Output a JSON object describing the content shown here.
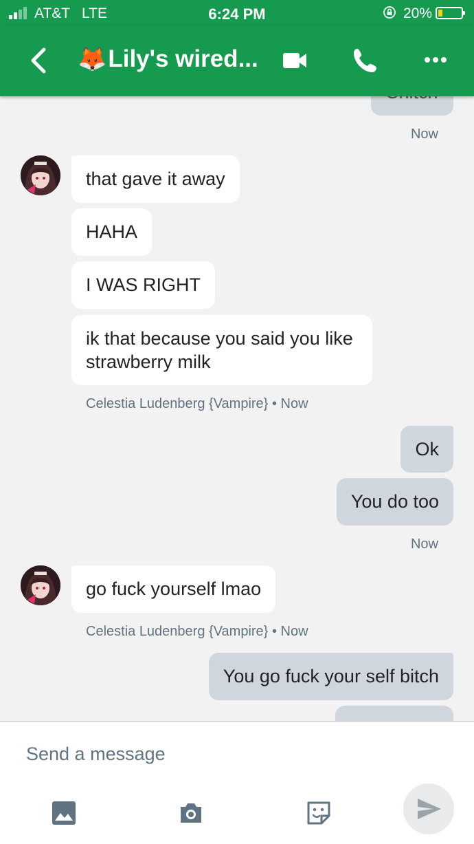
{
  "status_bar": {
    "carrier": "AT&T",
    "network": "LTE",
    "time": "6:24 PM",
    "battery_percent": "20%",
    "battery_level": 0.2,
    "signal_bars": 2,
    "icons": [
      "signal-icon",
      "orientation-lock-icon",
      "battery-icon"
    ]
  },
  "header": {
    "emoji": "🦊",
    "title": "Lily's wired...",
    "icons": [
      "back-icon",
      "video-call-icon",
      "phone-call-icon",
      "more-icon"
    ]
  },
  "messages": {
    "partial_top_text": "Chitch",
    "ts1": "Now",
    "in1": [
      "that gave it away",
      "HAHA",
      "I WAS RIGHT",
      "ik that because you said you like",
      "strawberry milk"
    ],
    "sender1": "Celestia Ludenberg {Vampire}",
    "sender1_time": "• Now",
    "out1": [
      "Ok",
      "You do too"
    ],
    "ts2": "Now",
    "in2": "go fuck yourself lmao",
    "sender2": "Celestia Ludenberg {Vampire}",
    "sender2_time": "• Now",
    "out2": "You go fuck your self bitch"
  },
  "composer": {
    "placeholder": "Send a message",
    "icons": [
      "image-icon",
      "camera-icon",
      "sticker-icon",
      "send-icon"
    ]
  },
  "colors": {
    "brand_green": "#159a50",
    "outgoing_bubble": "#cfd6dd",
    "incoming_bubble": "#ffffff",
    "meta_text": "#5f7380",
    "background": "#f2f2f2"
  }
}
